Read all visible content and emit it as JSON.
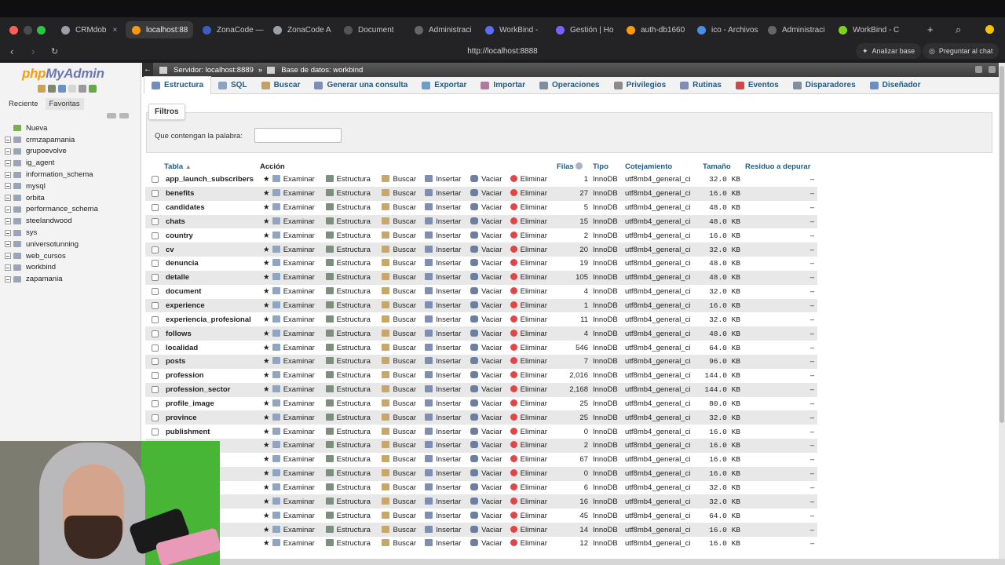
{
  "browser": {
    "tabs": [
      {
        "label": "CRMdob",
        "active": false,
        "color": "#9aa0a6"
      },
      {
        "label": "localhost:88",
        "active": true,
        "color": "#f89c0e"
      },
      {
        "label": "ZonaCode —",
        "active": false,
        "color": "#3b5fc0"
      },
      {
        "label": "ZonaCode A",
        "active": false,
        "color": "#9aa0a6"
      },
      {
        "label": "Document",
        "active": false,
        "color": "#555555"
      },
      {
        "label": "Administraci",
        "active": false,
        "color": "#666666"
      },
      {
        "label": "WorkBind - ",
        "active": false,
        "color": "#5b6ef5"
      },
      {
        "label": "Gestión | Ho",
        "active": false,
        "color": "#7b61ff"
      },
      {
        "label": "auth-db1660",
        "active": false,
        "color": "#f89c0e"
      },
      {
        "label": "ico - Archivos",
        "active": false,
        "color": "#4a90e2"
      },
      {
        "label": "Administraci",
        "active": false,
        "color": "#666666"
      },
      {
        "label": "WorkBind - C",
        "active": false,
        "color": "#7ed321"
      }
    ],
    "url": "http://localhost:8888",
    "analyze_label": "Analizar base",
    "ask_label": "Preguntar al chat"
  },
  "sidebar": {
    "logo_php": "php",
    "logo_myadmin": "MyAdmin",
    "tab_recent": "Reciente",
    "tab_favorites": "Favoritas",
    "databases": [
      "Nueva",
      "crmzapamania",
      "grupoevolve",
      "ig_agent",
      "information_schema",
      "mysql",
      "orbita",
      "performance_schema",
      "steelandwood",
      "sys",
      "universotunning",
      "web_cursos",
      "workbind",
      "zapamania"
    ]
  },
  "breadcrumb": {
    "server": "Servidor: localhost:8889",
    "separator": "»",
    "database": "Base de datos: workbind"
  },
  "menu": [
    "Estructura",
    "SQL",
    "Buscar",
    "Generar una consulta",
    "Exportar",
    "Importar",
    "Operaciones",
    "Privilegios",
    "Rutinas",
    "Eventos",
    "Disparadores",
    "Diseñador"
  ],
  "filters": {
    "legend": "Filtros",
    "label": "Que contengan la palabra:",
    "value": ""
  },
  "table": {
    "headers": {
      "tabla": "Tabla",
      "accion": "Acción",
      "filas": "Filas",
      "tipo": "Tipo",
      "cotejamiento": "Cotejamiento",
      "tamano": "Tamaño",
      "residuo": "Residuo a depurar"
    },
    "actions": {
      "examinar": "Examinar",
      "estructura": "Estructura",
      "buscar": "Buscar",
      "insertar": "Insertar",
      "vaciar": "Vaciar",
      "eliminar": "Eliminar"
    },
    "rows": [
      {
        "name": "app_launch_subscribers",
        "rows": "1",
        "type": "InnoDB",
        "collation": "utf8mb4_general_ci",
        "size": "32.0 KB",
        "overhead": "–"
      },
      {
        "name": "benefits",
        "rows": "27",
        "type": "InnoDB",
        "collation": "utf8mb4_general_ci",
        "size": "16.0 KB",
        "overhead": "–"
      },
      {
        "name": "candidates",
        "rows": "5",
        "type": "InnoDB",
        "collation": "utf8mb4_general_ci",
        "size": "48.0 KB",
        "overhead": "–"
      },
      {
        "name": "chats",
        "rows": "15",
        "type": "InnoDB",
        "collation": "utf8mb4_general_ci",
        "size": "48.0 KB",
        "overhead": "–"
      },
      {
        "name": "country",
        "rows": "2",
        "type": "InnoDB",
        "collation": "utf8mb4_general_ci",
        "size": "16.0 KB",
        "overhead": "–"
      },
      {
        "name": "cv",
        "rows": "20",
        "type": "InnoDB",
        "collation": "utf8mb4_general_ci",
        "size": "32.0 KB",
        "overhead": "–"
      },
      {
        "name": "denuncia",
        "rows": "19",
        "type": "InnoDB",
        "collation": "utf8mb4_general_ci",
        "size": "48.0 KB",
        "overhead": "–"
      },
      {
        "name": "detalle",
        "rows": "105",
        "type": "InnoDB",
        "collation": "utf8mb4_general_ci",
        "size": "48.0 KB",
        "overhead": "–"
      },
      {
        "name": "document",
        "rows": "4",
        "type": "InnoDB",
        "collation": "utf8mb4_general_ci",
        "size": "32.0 KB",
        "overhead": "–"
      },
      {
        "name": "experience",
        "rows": "1",
        "type": "InnoDB",
        "collation": "utf8mb4_general_ci",
        "size": "16.0 KB",
        "overhead": "–"
      },
      {
        "name": "experiencia_profesional",
        "rows": "11",
        "type": "InnoDB",
        "collation": "utf8mb4_general_ci",
        "size": "32.0 KB",
        "overhead": "–"
      },
      {
        "name": "follows",
        "rows": "4",
        "type": "InnoDB",
        "collation": "utf8mb4_general_ci",
        "size": "48.0 KB",
        "overhead": "–"
      },
      {
        "name": "localidad",
        "rows": "546",
        "type": "InnoDB",
        "collation": "utf8mb4_general_ci",
        "size": "64.0 KB",
        "overhead": "–"
      },
      {
        "name": "posts",
        "rows": "7",
        "type": "InnoDB",
        "collation": "utf8mb4_general_ci",
        "size": "96.0 KB",
        "overhead": "–"
      },
      {
        "name": "profession",
        "rows": "2,016",
        "type": "InnoDB",
        "collation": "utf8mb4_general_ci",
        "size": "144.0 KB",
        "overhead": "–"
      },
      {
        "name": "profession_sector",
        "rows": "2,168",
        "type": "InnoDB",
        "collation": "utf8mb4_general_ci",
        "size": "144.0 KB",
        "overhead": "–"
      },
      {
        "name": "profile_image",
        "rows": "25",
        "type": "InnoDB",
        "collation": "utf8mb4_general_ci",
        "size": "80.0 KB",
        "overhead": "–"
      },
      {
        "name": "province",
        "rows": "25",
        "type": "InnoDB",
        "collation": "utf8mb4_general_ci",
        "size": "32.0 KB",
        "overhead": "–"
      },
      {
        "name": "publishment",
        "rows": "0",
        "type": "InnoDB",
        "collation": "utf8mb4_general_ci",
        "size": "16.0 KB",
        "overhead": "–"
      },
      {
        "name": "",
        "rows": "2",
        "type": "InnoDB",
        "collation": "utf8mb4_general_ci",
        "size": "16.0 KB",
        "overhead": "–"
      },
      {
        "name": "",
        "rows": "67",
        "type": "InnoDB",
        "collation": "utf8mb4_general_ci",
        "size": "16.0 KB",
        "overhead": "–"
      },
      {
        "name": "",
        "rows": "0",
        "type": "InnoDB",
        "collation": "utf8mb4_general_ci",
        "size": "16.0 KB",
        "overhead": "–"
      },
      {
        "name": "",
        "rows": "6",
        "type": "InnoDB",
        "collation": "utf8mb4_general_ci",
        "size": "32.0 KB",
        "overhead": "–"
      },
      {
        "name": "",
        "rows": "16",
        "type": "InnoDB",
        "collation": "utf8mb4_general_ci",
        "size": "32.0 KB",
        "overhead": "–"
      },
      {
        "name": "",
        "rows": "45",
        "type": "InnoDB",
        "collation": "utf8mb4_general_ci",
        "size": "64.0 KB",
        "overhead": "–"
      },
      {
        "name": "",
        "rows": "14",
        "type": "InnoDB",
        "collation": "utf8mb4_general_ci",
        "size": "16.0 KB",
        "overhead": "–"
      },
      {
        "name": "",
        "rows": "12",
        "type": "InnoDB",
        "collation": "utf8mb4_general_ci",
        "size": "16.0 KB",
        "overhead": "–"
      }
    ]
  }
}
